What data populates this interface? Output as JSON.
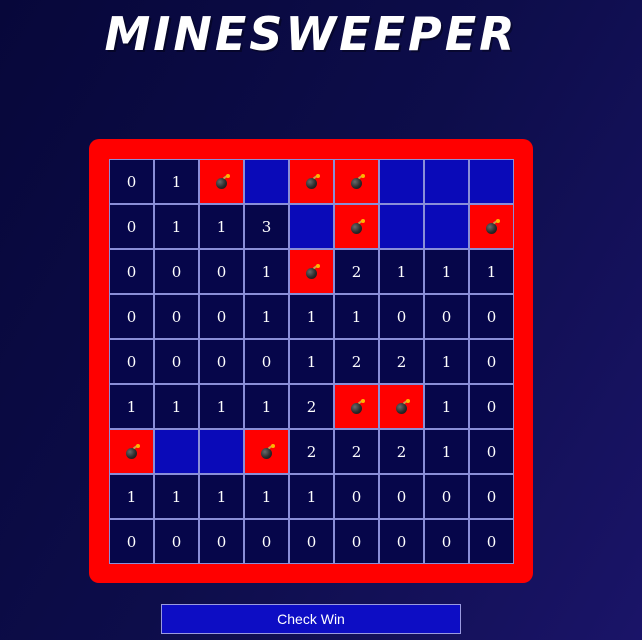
{
  "title": "MINESWEEPER",
  "check_button_label": "Check Win",
  "colors": {
    "frame": "#ff0000",
    "revealed": "#06064a",
    "hidden": "#0a0ab8",
    "mine": "#ff0000",
    "button": "#0d0dc4"
  },
  "board": [
    [
      "0",
      "1",
      "M",
      "H",
      "M",
      "M",
      "H",
      "H",
      "H"
    ],
    [
      "0",
      "1",
      "1",
      "3",
      "H",
      "M",
      "H",
      "H",
      "M"
    ],
    [
      "0",
      "0",
      "0",
      "1",
      "M",
      "2",
      "1",
      "1",
      "1"
    ],
    [
      "0",
      "0",
      "0",
      "1",
      "1",
      "1",
      "0",
      "0",
      "0"
    ],
    [
      "0",
      "0",
      "0",
      "0",
      "1",
      "2",
      "2",
      "1",
      "0"
    ],
    [
      "1",
      "1",
      "1",
      "1",
      "2",
      "M",
      "M",
      "1",
      "0"
    ],
    [
      "M",
      "H",
      "H",
      "M",
      "2",
      "2",
      "2",
      "1",
      "0"
    ],
    [
      "1",
      "1",
      "1",
      "1",
      "1",
      "0",
      "0",
      "0",
      "0"
    ],
    [
      "0",
      "0",
      "0",
      "0",
      "0",
      "0",
      "0",
      "0",
      "0"
    ]
  ],
  "legend": {
    "M": "bomb-icon",
    "H": "hidden-cell"
  }
}
